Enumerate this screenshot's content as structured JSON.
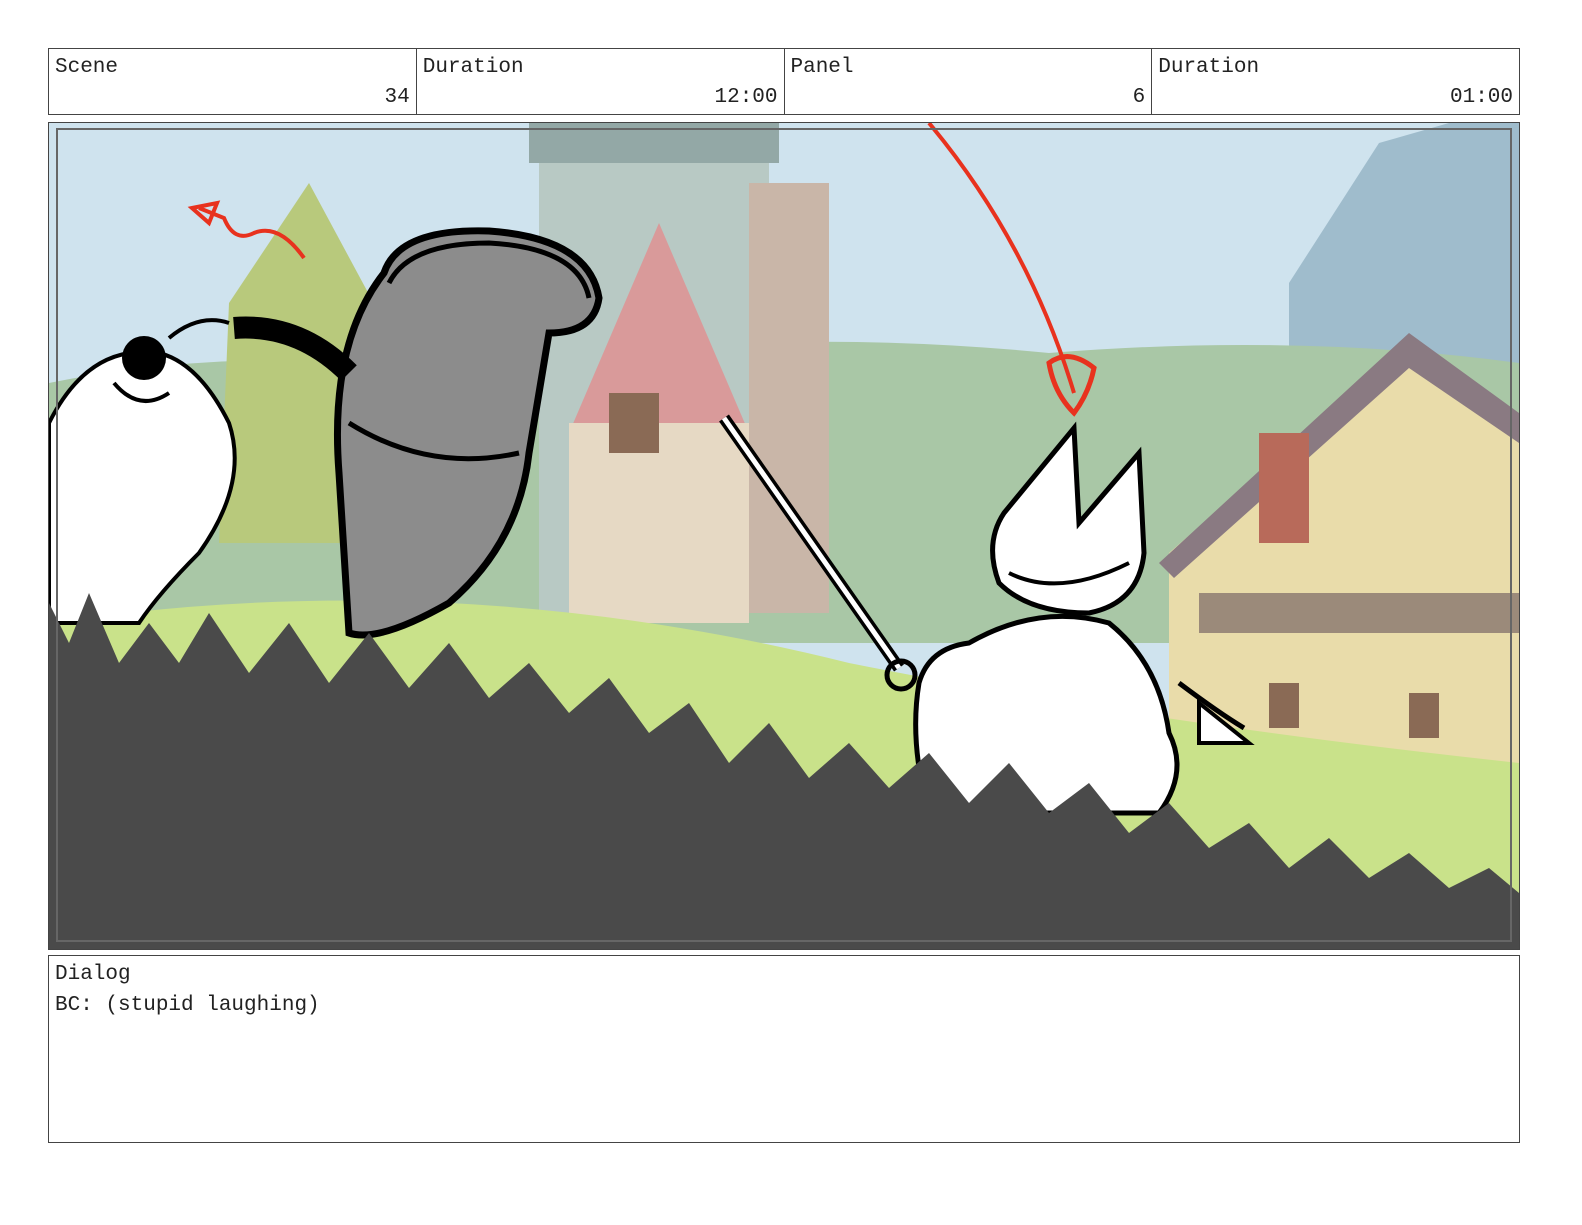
{
  "header": {
    "scene_label": "Scene",
    "scene_value": "34",
    "scene_duration_label": "Duration",
    "scene_duration_value": "12:00",
    "panel_label": "Panel",
    "panel_value": "6",
    "panel_duration_label": "Duration",
    "panel_duration_value": "01:00"
  },
  "dialog": {
    "label": "Dialog",
    "text": "BC: (stupid laughing)"
  },
  "colors": {
    "sky": "#cfe3ee",
    "grass": "#c9e28a",
    "foreground_silhouette": "#4a4a4a",
    "annotation_red": "#e8321e",
    "armor_gray": "#8c8c8c"
  }
}
